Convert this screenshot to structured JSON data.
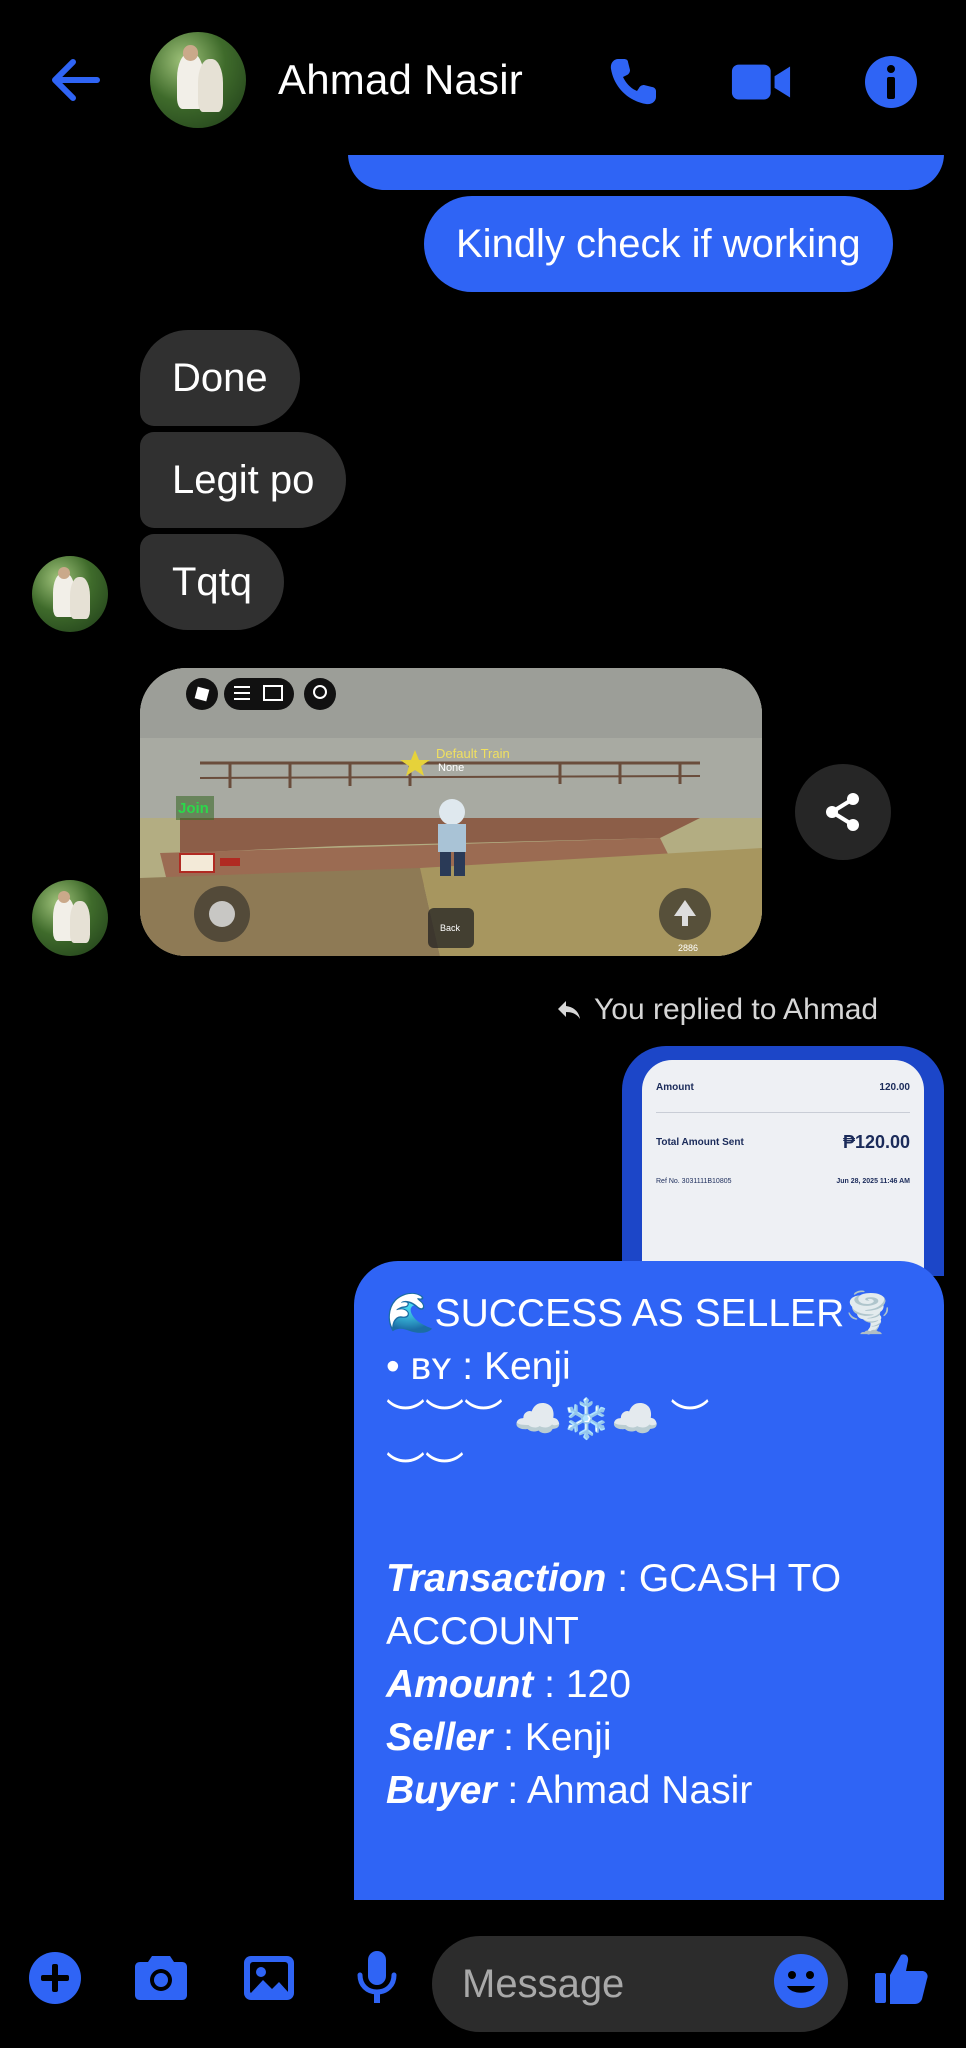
{
  "header": {
    "back_icon": "arrow-left-icon",
    "contact_name": "Ahmad Nasir",
    "icons": [
      "phone-icon",
      "video-camera-icon",
      "info-icon"
    ],
    "accent_color": "#2f64f5"
  },
  "messages": [
    {
      "from": "me",
      "text": "Kindly check if working"
    },
    {
      "from": "them",
      "text": "Done"
    },
    {
      "from": "them",
      "text": "Legit po"
    },
    {
      "from": "them",
      "text": "Tqtq"
    }
  ],
  "game_screenshot": {
    "join_label": "Join",
    "player_tag": "Default Train",
    "player_sub": "None",
    "back_button": "Back",
    "counter": "2886"
  },
  "reply_note": "You replied to Ahmad",
  "receipt": {
    "amount_label": "Amount",
    "amount_value": "120.00",
    "total_label": "Total Amount Sent",
    "total_value": "₱120.00",
    "ref_label": "Ref No. 3031111B10805",
    "datetime": "Jun 28, 2025 11:46 AM"
  },
  "success_message": {
    "title": "🌊SUCCESS AS SELLER🌪️",
    "by_prefix": "• ʙʏ : ",
    "by_name": "Kenji",
    "deco_line1": "︶︶︶ ☁️❄️☁️ ︶",
    "deco_line2": "︶︶",
    "transaction_label": "Transaction",
    "transaction_value": " : GCASH TO",
    "transaction_value2": "ACCOUNT",
    "amount_label": "Amount",
    "amount_value": " : 120",
    "seller_label": "Seller",
    "seller_value": " : Kenji",
    "buyer_label": "Buyer",
    "buyer_value": " : Ahmad Nasir"
  },
  "composer": {
    "placeholder": "Message",
    "icons": [
      "plus-icon",
      "camera-icon",
      "image-icon",
      "microphone-icon",
      "emoji-icon",
      "thumbs-up-icon"
    ]
  }
}
